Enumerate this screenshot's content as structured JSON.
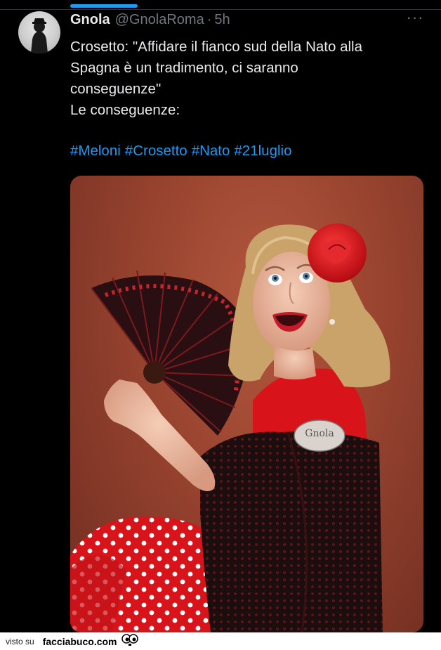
{
  "tweet": {
    "author_name": "Gnola",
    "handle": "@GnolaRoma",
    "separator": "·",
    "time": "5h",
    "more_label": "···",
    "text_lines": [
      "Crosetto: \"Affidare il fianco sud della Nato alla",
      "Spagna è un tradimento, ci saranno",
      "conseguenze\"",
      "Le conseguenze:"
    ],
    "hashtags": [
      "#Meloni",
      "#Crosetto",
      "#Nato",
      "#21luglio"
    ],
    "image_watermark": "Gnola"
  },
  "footer": {
    "visto_su": "visto su",
    "brand": "facciabuco.com"
  },
  "colors": {
    "background": "#000000",
    "text": "#e7e9ea",
    "muted": "#71767b",
    "link": "#1d9bf0"
  },
  "icons": [
    "more-icon",
    "avatar-image",
    "eyes-icon"
  ]
}
